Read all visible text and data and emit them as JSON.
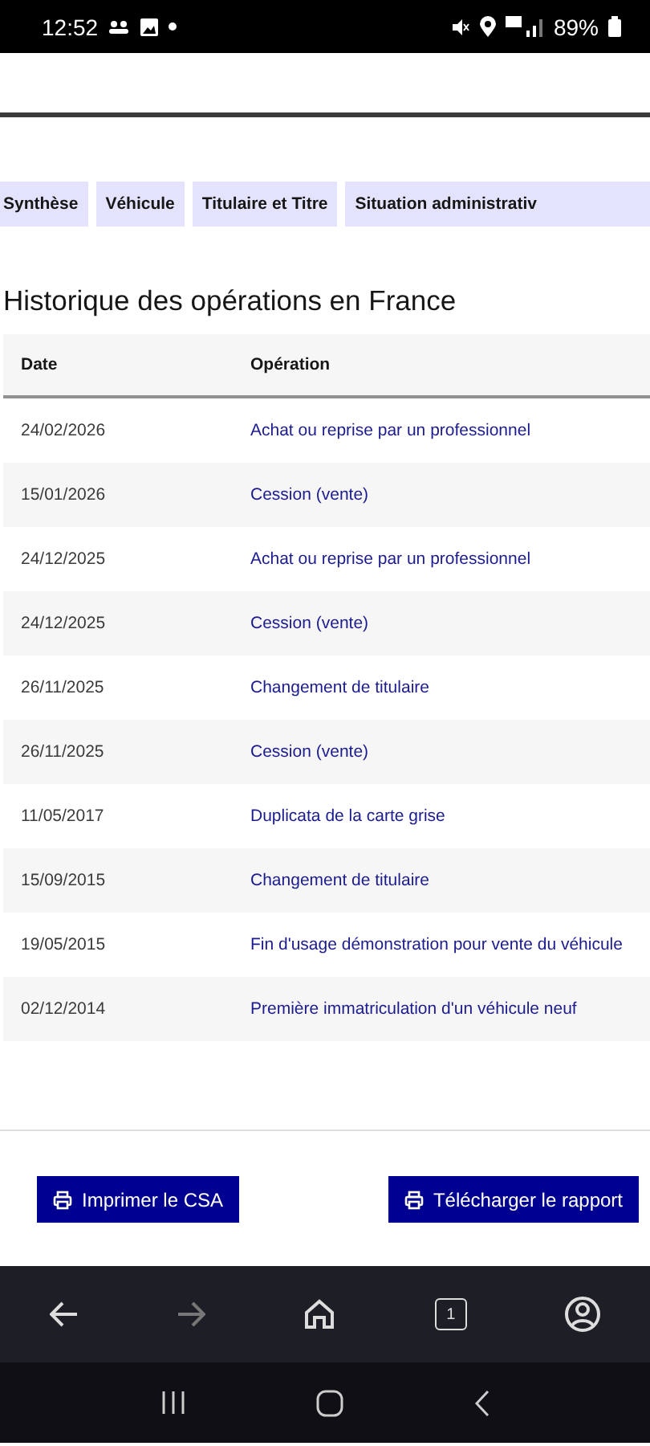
{
  "status_bar": {
    "time": "12:52",
    "battery": "89%"
  },
  "tabs": [
    {
      "label": "Synthèse",
      "selected": false
    },
    {
      "label": "Véhicule",
      "selected": false
    },
    {
      "label": "Titulaire et Titre",
      "selected": false
    },
    {
      "label": "Situation administrativ",
      "selected": false
    }
  ],
  "section_title": "Historique des opérations en France",
  "table": {
    "columns": [
      "Date",
      "Opération"
    ],
    "rows": [
      {
        "date": "24/02/2026",
        "operation": "Achat ou reprise par un professionnel"
      },
      {
        "date": "15/01/2026",
        "operation": "Cession (vente)"
      },
      {
        "date": "24/12/2025",
        "operation": "Achat ou reprise par un professionnel"
      },
      {
        "date": "24/12/2025",
        "operation": "Cession (vente)"
      },
      {
        "date": "26/11/2025",
        "operation": "Changement de titulaire"
      },
      {
        "date": "26/11/2025",
        "operation": "Cession (vente)"
      },
      {
        "date": "11/05/2017",
        "operation": "Duplicata de la carte grise"
      },
      {
        "date": "15/09/2015",
        "operation": "Changement de titulaire"
      },
      {
        "date": "19/05/2015",
        "operation": "Fin d'usage démonstration pour vente du véhicule"
      },
      {
        "date": "02/12/2014",
        "operation": "Première immatriculation d'un véhicule neuf"
      }
    ]
  },
  "buttons": [
    "Imprimer le CSA",
    "Télécharger le rapport"
  ],
  "browser_bar": {
    "tab_count": "1"
  }
}
